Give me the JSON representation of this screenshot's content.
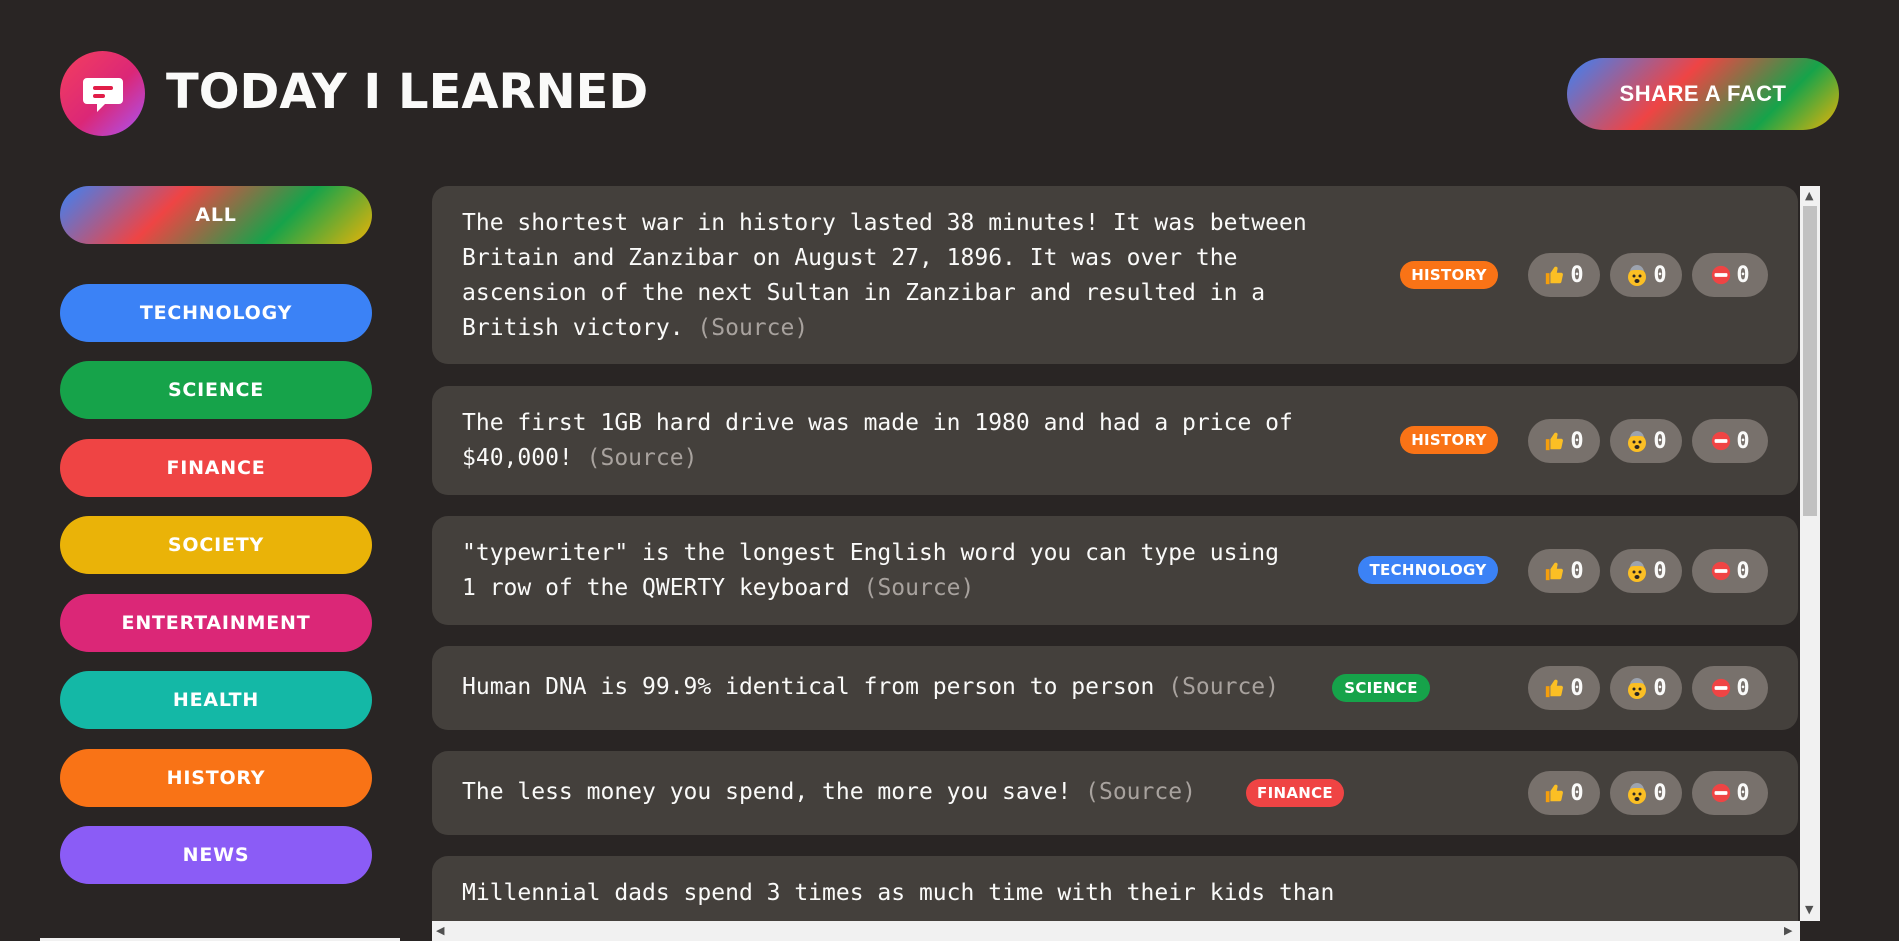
{
  "header": {
    "title": "TODAY I LEARNED",
    "share_label": "SHARE A FACT",
    "logo_icon": "chat-bubble-icon"
  },
  "categories": [
    {
      "label": "ALL"
    },
    {
      "label": "TECHNOLOGY",
      "color": "#3b82f6"
    },
    {
      "label": "SCIENCE",
      "color": "#16a34a"
    },
    {
      "label": "FINANCE",
      "color": "#ef4444"
    },
    {
      "label": "SOCIETY",
      "color": "#eab308"
    },
    {
      "label": "ENTERTAINMENT",
      "color": "#db2777"
    },
    {
      "label": "HEALTH",
      "color": "#14b8a6"
    },
    {
      "label": "HISTORY",
      "color": "#f97316"
    },
    {
      "label": "NEWS",
      "color": "#8b5cf6"
    }
  ],
  "facts": [
    {
      "lines": [
        "The shortest war in history lasted 38 minutes! It was between",
        "Britain and Zanzibar on August 27, 1896. It was over the",
        "ascension of the next Sultan in Zanzibar and resulted in a",
        "British victory."
      ],
      "source": "(Source)",
      "tag": "HISTORY",
      "tag_color": "#f97316",
      "votes": [
        "0",
        "0",
        "0"
      ]
    },
    {
      "lines": [
        "The first 1GB hard drive was made in 1980 and had a price of",
        "$40,000!"
      ],
      "source": "(Source)",
      "tag": "HISTORY",
      "tag_color": "#f97316",
      "votes": [
        "0",
        "0",
        "0"
      ]
    },
    {
      "lines": [
        "\"typewriter\" is the longest English word you can type using",
        "1 row of the QWERTY keyboard"
      ],
      "source": "(Source)",
      "tag": "TECHNOLOGY",
      "tag_color": "#3b82f6",
      "votes": [
        "0",
        "0",
        "0"
      ]
    },
    {
      "lines": [
        "Human DNA is 99.9% identical from person to person"
      ],
      "source": "(Source)",
      "tag": "SCIENCE",
      "tag_color": "#16a34a",
      "votes": [
        "0",
        "0",
        "0"
      ]
    },
    {
      "lines": [
        "The less money you spend, the more you save!"
      ],
      "source": "(Source)",
      "tag": "FINANCE",
      "tag_color": "#ef4444",
      "votes": [
        "0",
        "0",
        "0"
      ]
    },
    {
      "lines": [
        "Millennial dads spend 3 times as much time with their kids than"
      ],
      "source": "",
      "tag": "",
      "tag_color": "",
      "votes": []
    }
  ],
  "vote_icons": [
    "thumbs-up-icon",
    "mind-blown-icon",
    "no-entry-icon"
  ]
}
